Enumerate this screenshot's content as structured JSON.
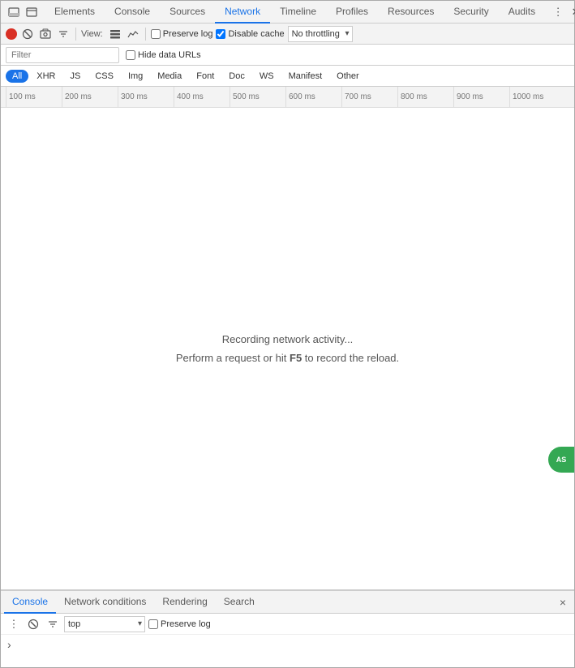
{
  "devtools": {
    "top_tabs": [
      {
        "label": "Elements",
        "active": false
      },
      {
        "label": "Console",
        "active": false
      },
      {
        "label": "Sources",
        "active": false
      },
      {
        "label": "Network",
        "active": true
      },
      {
        "label": "Timeline",
        "active": false
      },
      {
        "label": "Profiles",
        "active": false
      },
      {
        "label": "Resources",
        "active": false
      },
      {
        "label": "Security",
        "active": false
      },
      {
        "label": "Audits",
        "active": false
      }
    ],
    "network_toolbar": {
      "view_label": "View:",
      "preserve_log_label": "Preserve log",
      "disable_cache_label": "Disable cache",
      "throttle_value": "No throttling",
      "preserve_log_checked": false,
      "disable_cache_checked": true
    },
    "filter_row": {
      "placeholder": "Filter",
      "hide_data_urls_label": "Hide data URLs"
    },
    "filter_tabs": [
      {
        "label": "All",
        "active": true
      },
      {
        "label": "XHR"
      },
      {
        "label": "JS"
      },
      {
        "label": "CSS"
      },
      {
        "label": "Img"
      },
      {
        "label": "Media"
      },
      {
        "label": "Font"
      },
      {
        "label": "Doc"
      },
      {
        "label": "WS"
      },
      {
        "label": "Manifest"
      },
      {
        "label": "Other"
      }
    ],
    "timeline_ticks": [
      "100 ms",
      "200 ms",
      "300 ms",
      "400 ms",
      "500 ms",
      "600 ms",
      "700 ms",
      "800 ms",
      "900 ms",
      "1000 ms"
    ],
    "empty_state": {
      "line1": "Recording network activity...",
      "line2_prefix": "Perform a request or hit ",
      "line2_key": "F5",
      "line2_suffix": " to record the reload."
    },
    "bottom_panel": {
      "tabs": [
        {
          "label": "Console",
          "active": true
        },
        {
          "label": "Network conditions"
        },
        {
          "label": "Rendering"
        },
        {
          "label": "Search"
        }
      ],
      "close_label": "×",
      "console_toolbar": {
        "no_icon": "🚫",
        "filter_icon": "⊘",
        "top_option": "top",
        "preserve_log_label": "Preserve log",
        "preserve_log_checked": false
      },
      "console_prompt_icon": "›"
    }
  }
}
